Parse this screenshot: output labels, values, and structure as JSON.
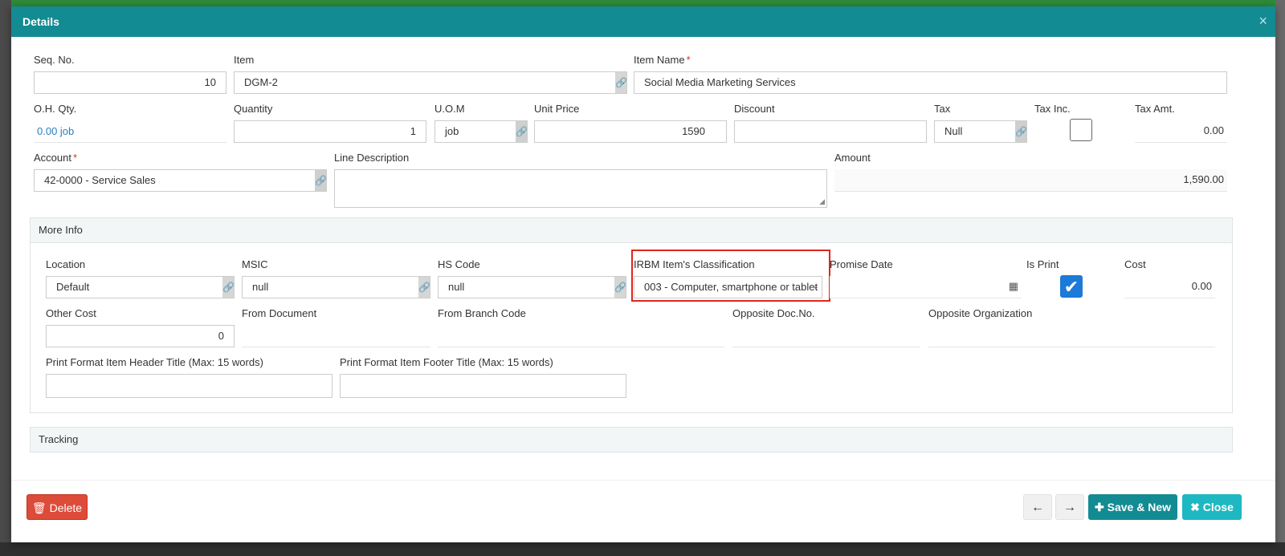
{
  "dialog": {
    "title": "Details",
    "close_glyph": "×"
  },
  "line": {
    "seq_no": {
      "label": "Seq. No.",
      "value": "10"
    },
    "item": {
      "label": "Item",
      "value": "DGM-2"
    },
    "item_name": {
      "label": "Item Name",
      "value": "Social Media Marketing Services",
      "required": "*"
    },
    "oh_qty": {
      "label": "O.H. Qty.",
      "value": "0.00 job"
    },
    "quantity": {
      "label": "Quantity",
      "value": "1"
    },
    "uom": {
      "label": "U.O.M",
      "value": "job"
    },
    "unit_price": {
      "label": "Unit Price",
      "value": "1590"
    },
    "discount": {
      "label": "Discount",
      "value": ""
    },
    "tax": {
      "label": "Tax",
      "value": "Null"
    },
    "tax_inc": {
      "label": "Tax Inc.",
      "checked": false
    },
    "tax_amt": {
      "label": "Tax Amt.",
      "value": "0.00"
    },
    "account": {
      "label": "Account",
      "value": "42-0000 - Service Sales",
      "required": "*"
    },
    "line_description": {
      "label": "Line Description",
      "value": ""
    },
    "amount": {
      "label": "Amount",
      "value": "1,590.00"
    }
  },
  "more_info": {
    "title": "More Info",
    "location": {
      "label": "Location",
      "value": "Default"
    },
    "msic": {
      "label": "MSIC",
      "value": "null"
    },
    "hs_code": {
      "label": "HS Code",
      "value": "null"
    },
    "irbm_classification": {
      "label": "IRBM Item's Classification",
      "value": "003 - Computer, smartphone or tablet"
    },
    "promise_date": {
      "label": "Promise Date",
      "value": ""
    },
    "is_print": {
      "label": "Is Print",
      "checked": true
    },
    "cost": {
      "label": "Cost",
      "value": "0.00"
    },
    "other_cost": {
      "label": "Other Cost",
      "value": "0"
    },
    "from_document": {
      "label": "From Document",
      "value": ""
    },
    "from_branch_code": {
      "label": "From Branch Code",
      "value": ""
    },
    "opposite_doc_no": {
      "label": "Opposite Doc.No.",
      "value": ""
    },
    "opposite_organization": {
      "label": "Opposite Organization",
      "value": ""
    },
    "print_header_title": {
      "label": "Print Format Item Header Title (Max: 15 words)",
      "value": ""
    },
    "print_footer_title": {
      "label": "Print Format Item Footer Title (Max: 15 words)",
      "value": ""
    }
  },
  "tracking": {
    "title": "Tracking"
  },
  "footer": {
    "delete_label": "Delete",
    "prev_icon": "←",
    "next_icon": "→",
    "save_new_label": "Save & New",
    "close_label": "Close"
  },
  "icons": {
    "link": "link-icon",
    "calendar": "calendar-icon",
    "trash": "trash-icon",
    "plus": "plus-icon",
    "times": "times-icon",
    "check": "check-icon"
  },
  "colors": {
    "header": "#138b93",
    "delete": "#dd4b39",
    "save": "#138b93",
    "close": "#1eb8c2",
    "highlight": "#e0261c",
    "checkbox": "#1c7ad8"
  }
}
